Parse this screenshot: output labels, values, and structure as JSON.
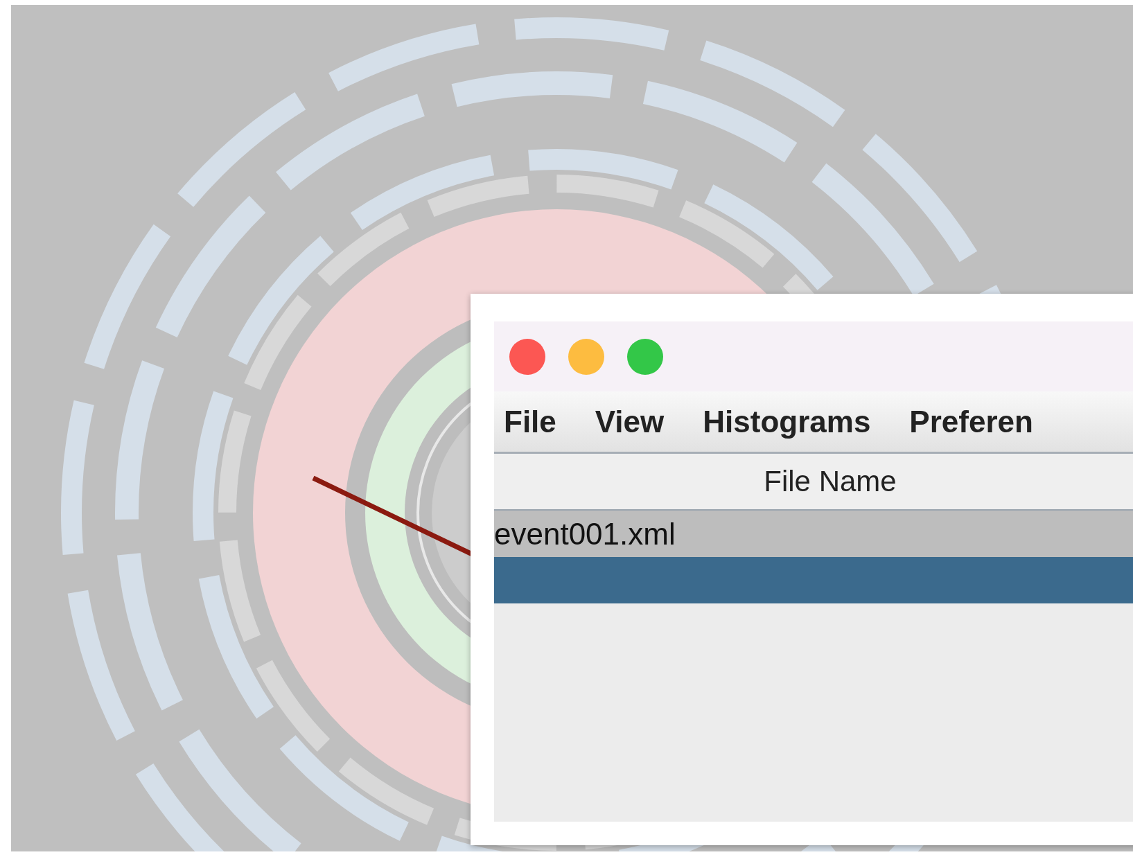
{
  "window": {
    "buttons": [
      {
        "kind": "close"
      },
      {
        "kind": "minimize"
      },
      {
        "kind": "zoom"
      }
    ],
    "menu": [
      "File",
      "View",
      "Histograms",
      "Preferen"
    ],
    "table": {
      "columns": [
        "File Name"
      ],
      "rows": [
        {
          "file_name": "event001.xml",
          "selected": false
        },
        {
          "selected": true
        }
      ]
    }
  }
}
